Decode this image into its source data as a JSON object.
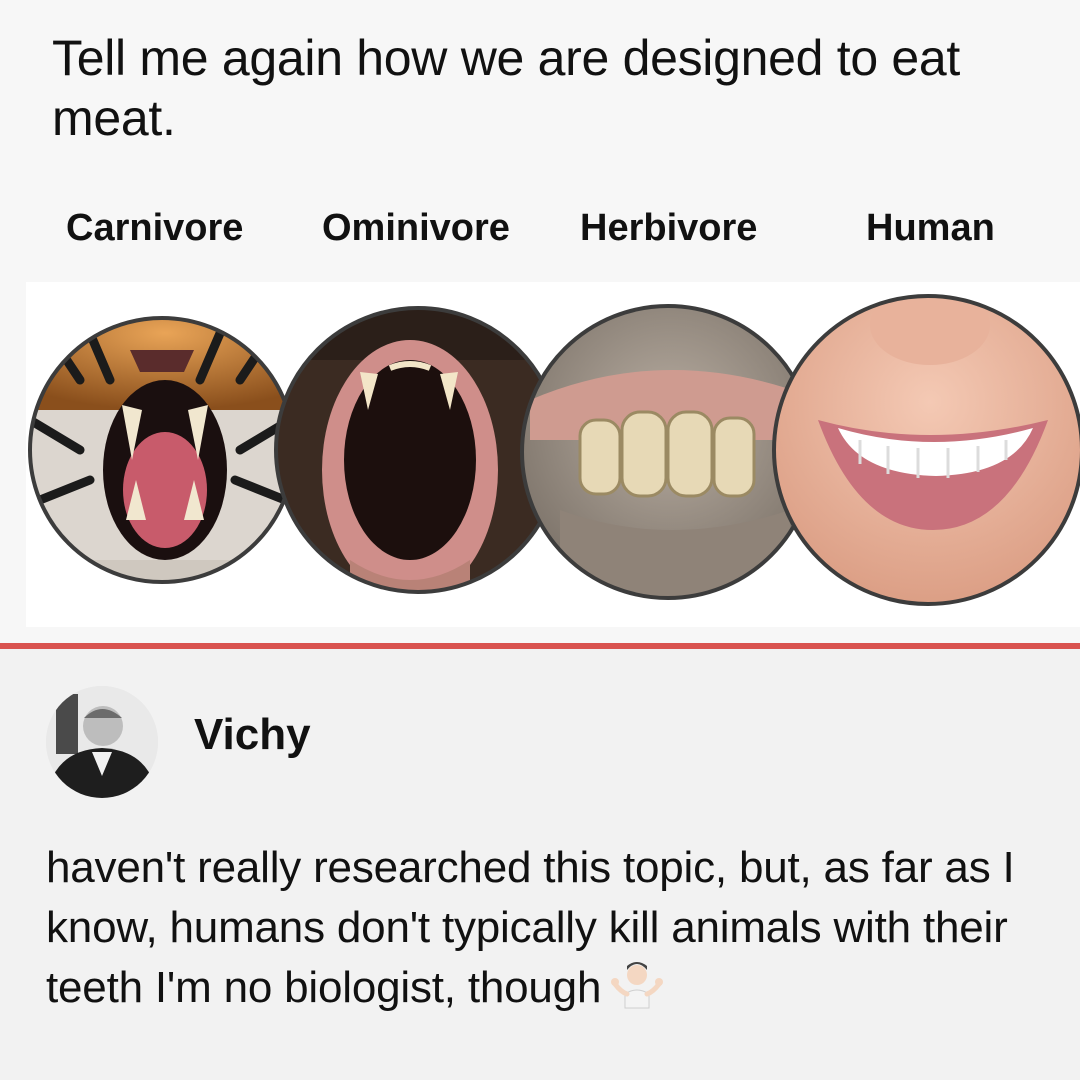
{
  "post": {
    "text": "Tell me again how we are designed to eat meat."
  },
  "comparison": {
    "labels": [
      "Carnivore",
      "Ominivore",
      "Herbivore",
      "Human"
    ]
  },
  "comment": {
    "author": "Vichy",
    "text": "haven't really researched this topic, but, as far as I know, humans don't typically kill animals with their teeth I'm no biologist, though",
    "emoji": "person-shrugging-emoji"
  },
  "colors": {
    "divider": "#d9534f",
    "background": "#f3f3f3"
  }
}
